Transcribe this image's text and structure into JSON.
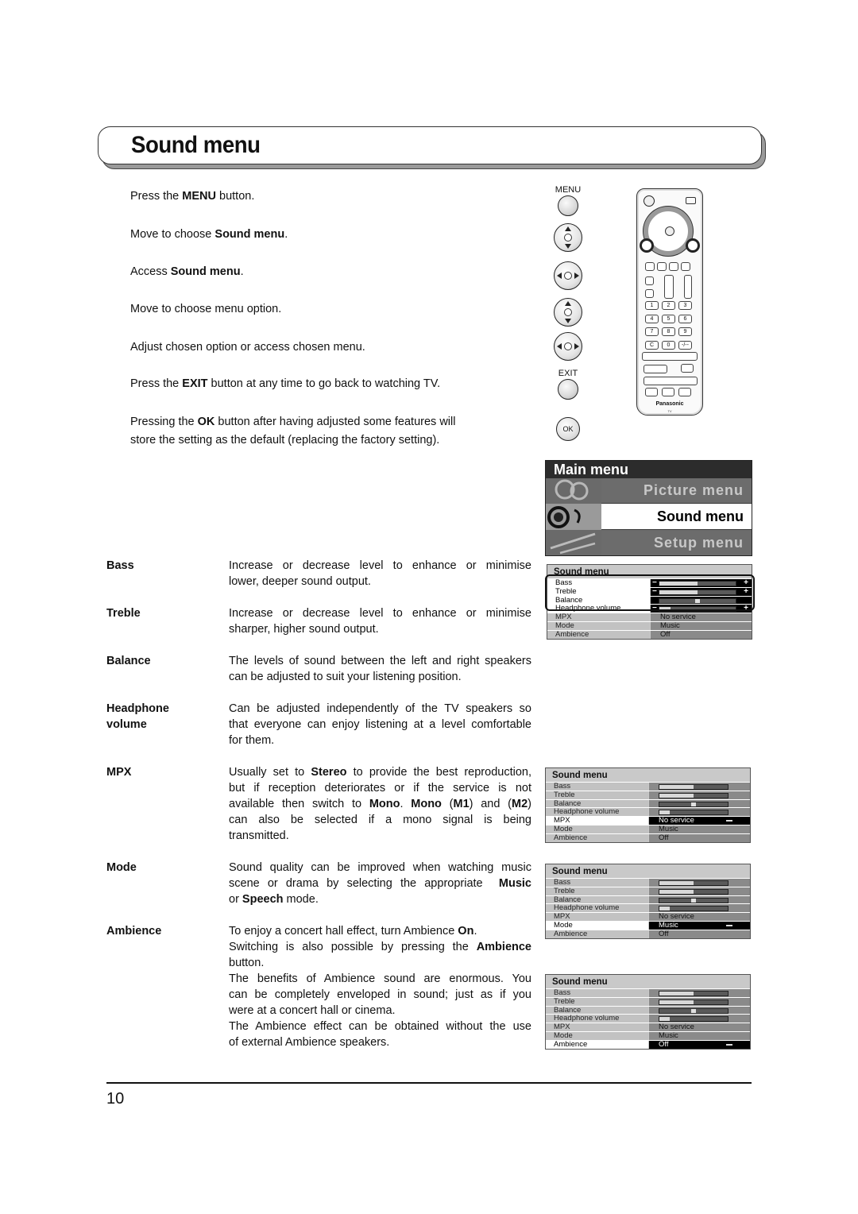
{
  "page": {
    "title": "Sound menu",
    "page_number": "10"
  },
  "steps": [
    {
      "pre": "Press the ",
      "bold": "MENU",
      "post": " button."
    },
    {
      "pre": "Move to choose ",
      "bold": "Sound menu",
      "post": "."
    },
    {
      "pre": "Access ",
      "bold": "Sound menu",
      "post": "."
    },
    {
      "pre": "Move to choose menu option.",
      "bold": "",
      "post": ""
    },
    {
      "pre": "Adjust chosen option or access chosen menu.",
      "bold": "",
      "post": ""
    },
    {
      "pre": "Press the ",
      "bold": "EXIT",
      "post": " button at any time to go back to watching TV."
    },
    {
      "pre": "Pressing the ",
      "bold": "OK",
      "post": " button after having adjusted some features will"
    },
    {
      "pre": "store the setting as the default (replacing the factory setting).",
      "bold": "",
      "post": ""
    }
  ],
  "buttons": {
    "menu_label": "MENU",
    "exit_label": "EXIT",
    "ok_label": "OK",
    "icons": [
      "menu-button-icon",
      "up-down-nav-icon",
      "left-right-nav-icon",
      "up-down-nav-icon",
      "left-right-nav-icon",
      "exit-button-icon",
      "ok-button-icon"
    ]
  },
  "remote": {
    "brand": "Panasonic",
    "sub": "TV",
    "number_keys": [
      "1",
      "2",
      "3",
      "4",
      "5",
      "6",
      "7",
      "8",
      "9",
      "C",
      "0",
      "-/--"
    ]
  },
  "main_menu": {
    "title": "Main menu",
    "items": [
      {
        "label": "Picture menu",
        "selected": false
      },
      {
        "label": "Sound menu",
        "selected": true
      },
      {
        "label": "Setup menu",
        "selected": false
      }
    ]
  },
  "descriptions": [
    {
      "term": [
        "Bass"
      ],
      "lines": [
        "Increase or decrease level to enhance or minimise",
        "lower, deeper sound output."
      ]
    },
    {
      "term": [
        "Treble"
      ],
      "lines": [
        "Increase or decrease level to enhance or minimise",
        "sharper, higher sound output."
      ]
    },
    {
      "term": [
        "Balance"
      ],
      "lines": [
        "The levels of sound between the left and right speakers",
        "can be adjusted to suit your listening position."
      ]
    },
    {
      "term": [
        "Headphone",
        "volume"
      ],
      "lines": [
        "Can be adjusted independently of the TV speakers so",
        "that everyone can enjoy listening at a level comfortable",
        "for them."
      ]
    },
    {
      "term": [
        "MPX"
      ],
      "lines_html": [
        "Usually set to <b>Stereo</b> to provide the best reproduction,",
        "but if reception deteriorates or if the service is not",
        "available then switch to <b>Mono</b>. <b>Mono</b> (<b>M1</b>) and (<b>M2</b>)",
        "can also be selected if a mono signal is being",
        "transmitted."
      ]
    },
    {
      "term": [
        "Mode"
      ],
      "lines_html": [
        "Sound quality can be improved when watching music",
        "scene or drama by selecting the appropriate &nbsp;<b>Music</b>",
        "or <b>Speech</b> mode."
      ]
    },
    {
      "term": [
        "Ambience"
      ],
      "lines_html": [
        "To enjoy a concert hall effect, turn Ambience <b>On</b>.",
        "Switching is also possible by pressing the <b>Ambience</b>",
        "button.",
        "The benefits of Ambience sound are enormous. You",
        "can be completely enveloped in sound; just as if you",
        "were at a concert hall or cinema.",
        "The Ambience effect can be obtained without the use",
        "of external Ambience speakers."
      ]
    }
  ],
  "sound_menu": {
    "title": "Sound menu",
    "rows": [
      {
        "label": "Bass",
        "type": "bar",
        "level": 0.5
      },
      {
        "label": "Treble",
        "type": "bar",
        "level": 0.5
      },
      {
        "label": "Balance",
        "type": "balance",
        "level": 0.5
      },
      {
        "label": "Headphone volume",
        "type": "bar",
        "level": 0.15
      },
      {
        "label": "MPX",
        "type": "text",
        "value": "No service"
      },
      {
        "label": "Mode",
        "type": "text",
        "value": "Music"
      },
      {
        "label": "Ambience",
        "type": "text",
        "value": "Off"
      }
    ],
    "panels": [
      {
        "highlight": [
          "Bass",
          "Treble",
          "Balance",
          "Headphone volume"
        ],
        "mode": "adjust"
      },
      {
        "highlight": [
          "MPX"
        ],
        "mode": "select"
      },
      {
        "highlight": [
          "Mode"
        ],
        "mode": "select"
      },
      {
        "highlight": [
          "Ambience"
        ],
        "mode": "select"
      }
    ]
  }
}
